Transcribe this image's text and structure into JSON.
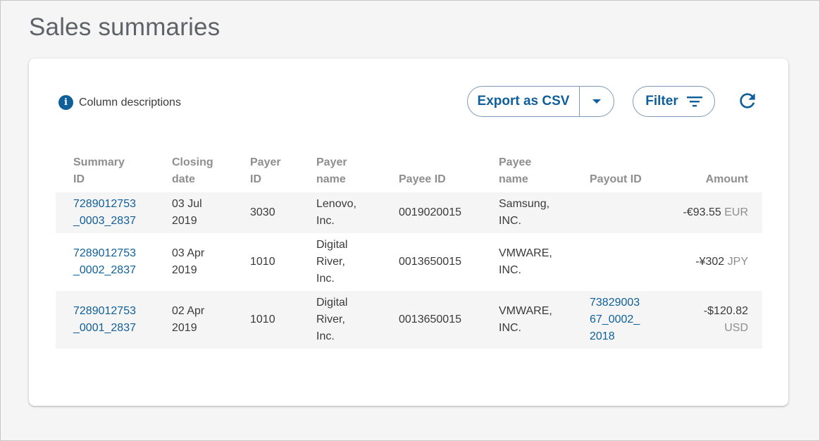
{
  "page": {
    "title": "Sales summaries"
  },
  "toolbar": {
    "column_descriptions": "Column descriptions",
    "export_label": "Export as CSV",
    "filter_label": "Filter"
  },
  "table": {
    "headers": {
      "summary_id": "Summary ID",
      "closing_date": "Closing date",
      "payer_id": "Payer ID",
      "payer_name": "Payer name",
      "payee_id": "Payee ID",
      "payee_name": "Payee name",
      "payout_id": "Payout ID",
      "amount": "Amount"
    },
    "rows": [
      {
        "summary_id": "7289012753_0003_2837",
        "closing_date": "03 Jul 2019",
        "payer_id": "3030",
        "payer_name": "Lenovo, Inc.",
        "payee_id": "0019020015",
        "payee_name": "Samsung, INC.",
        "payout_id": "",
        "amount": "-€93.55",
        "currency": "EUR"
      },
      {
        "summary_id": "7289012753_0002_2837",
        "closing_date": "03 Apr 2019",
        "payer_id": "1010",
        "payer_name": "Digital River, Inc.",
        "payee_id": "0013650015",
        "payee_name": "VMWARE, INC.",
        "payout_id": "",
        "amount": "-¥302",
        "currency": "JPY"
      },
      {
        "summary_id": "7289012753_0001_2837",
        "closing_date": "02 Apr 2019",
        "payer_id": "1010",
        "payer_name": "Digital River, Inc.",
        "payee_id": "0013650015",
        "payee_name": "VMWARE, INC.",
        "payout_id": "7382900367_0002_2018",
        "amount": "-$120.82",
        "currency": "USD"
      }
    ]
  }
}
